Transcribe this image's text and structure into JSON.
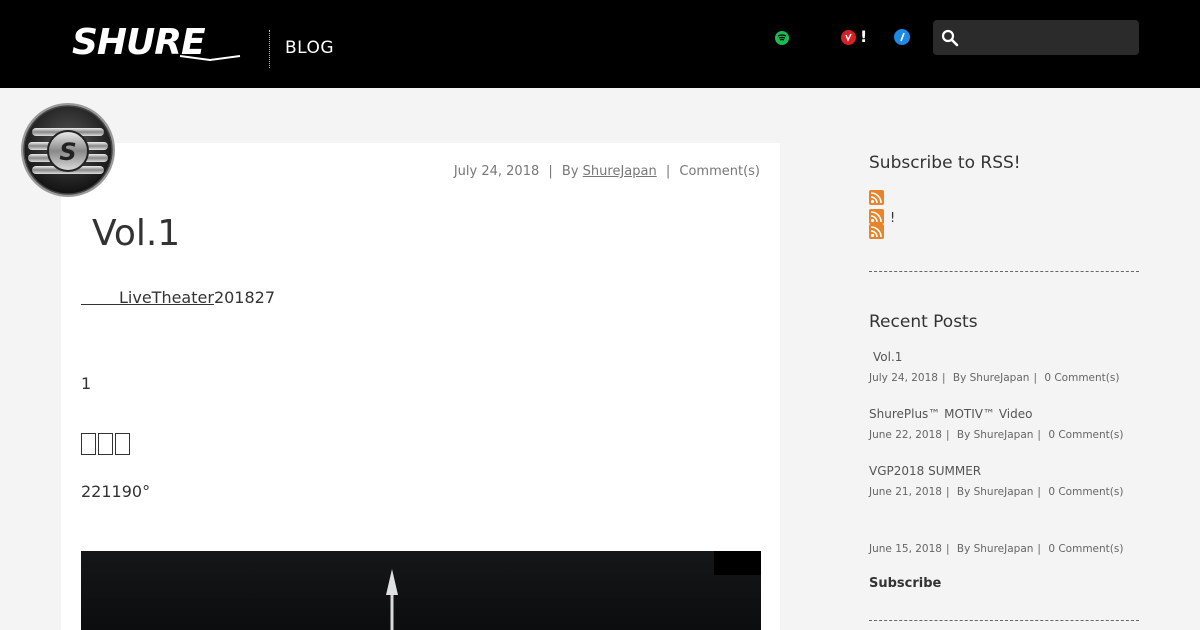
{
  "header": {
    "logo_text": "SHURE",
    "blog_label": "BLOG",
    "icons": [
      "spotify-icon",
      "red-circle-icon",
      "blue-circle-icon"
    ],
    "exclamation": "!",
    "search": {
      "placeholder": "",
      "value": ""
    }
  },
  "post": {
    "meta": {
      "date": "July 24, 2018",
      "by_label": "By",
      "author": "ShureJapan",
      "comments": "Comment(s)"
    },
    "title": "Vol.1",
    "paragraph1": {
      "link": "LiveTheater",
      "rest": "201827"
    },
    "paragraph2": "1",
    "paragraph3": "221190°"
  },
  "sidebar": {
    "rss_heading": "Subscribe to RSS!",
    "rss_excl": "!",
    "recent_heading": "Recent Posts",
    "recent_posts": [
      {
        "title": "Vol.1",
        "date": "July 24, 2018",
        "author": "By ShureJapan",
        "comments": "0 Comment(s)"
      },
      {
        "title": "ShurePlus™ MOTIV™ Video",
        "date": "June 22, 2018",
        "author": "By ShureJapan",
        "comments": "0 Comment(s)"
      },
      {
        "title": "VGP2018 SUMMER",
        "date": "June 21, 2018",
        "author": "By ShureJapan",
        "comments": "0 Comment(s)"
      },
      {
        "title": "",
        "date": "June 15, 2018",
        "author": "By ShureJapan",
        "comments": "0 Comment(s)"
      }
    ],
    "subscribe_label": "Subscribe"
  },
  "colors": {
    "header_bg": "#000000",
    "page_bg": "#f4f4f4",
    "card_bg": "#ffffff",
    "rss_orange": "#e8842a",
    "spotify_green": "#1db954"
  }
}
